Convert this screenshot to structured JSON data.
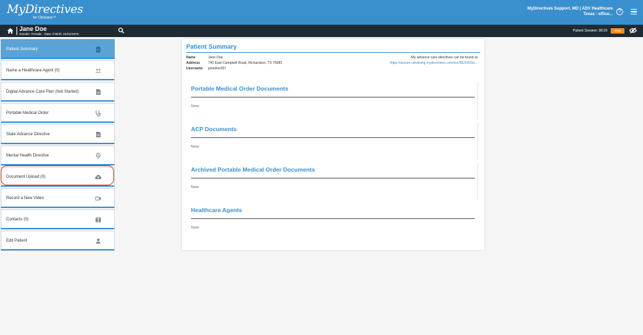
{
  "header": {
    "logo_main": "MyDirectives",
    "logo_sub": "for Clinicians™",
    "user_line1": "MyDirectives Support, MD | ADV Healthcare",
    "user_line2": "Texas - office...",
    "help_icon": "question-circle-icon",
    "menu_icon": "hamburger-menu-icon"
  },
  "patient_bar": {
    "name": "Jane Doe",
    "meta": "Gender: Female · Date of Birth: 01/01/1970",
    "session": "Patient Session: 08:29",
    "stop_label": "Stop",
    "home_icon": "home-icon",
    "search_icon": "search-icon",
    "eye_icon": "eye-off-icon"
  },
  "sidebar": {
    "items": [
      {
        "label": "Patient Summary",
        "icon": "clipboard-icon"
      },
      {
        "label": "Name a Healthcare Agent (0)",
        "icon": "people-icon"
      },
      {
        "label": "Digital Advance Care Plan (Not Started)",
        "icon": "document-icon"
      },
      {
        "label": "Portable Medical Order",
        "icon": "stethoscope-icon"
      },
      {
        "label": "State Advance Directive",
        "icon": "document-icon"
      },
      {
        "label": "Mental Health Directive",
        "icon": "brain-icon"
      },
      {
        "label": "Document Upload (0)",
        "icon": "cloud-upload-icon"
      },
      {
        "label": "Record a New Video",
        "icon": "video-camera-icon"
      },
      {
        "label": "Contacts (0)",
        "icon": "contacts-icon"
      },
      {
        "label": "Edit Patient",
        "icon": "person-icon"
      }
    ]
  },
  "summary": {
    "title": "Patient Summary",
    "name_label": "Name",
    "name_value": "Jane Doe",
    "address_label": "Address",
    "address_value": "740 East Campbell Road, Richardson, TX 75081",
    "username_label": "Username",
    "username_value": "janedoe367",
    "adv_text": "My advance care directives can be found at",
    "adv_link": "https://secure-uitraining.mydirectives.com/ice/982541bd..."
  },
  "sections": [
    {
      "title": "Portable Medical Order Documents",
      "empty": "None"
    },
    {
      "title": "ACP Documents",
      "empty": "None"
    },
    {
      "title": "Archived Portable Medical Order Documents",
      "empty": "None"
    },
    {
      "title": "Healthcare Agents",
      "empty": "None"
    }
  ]
}
